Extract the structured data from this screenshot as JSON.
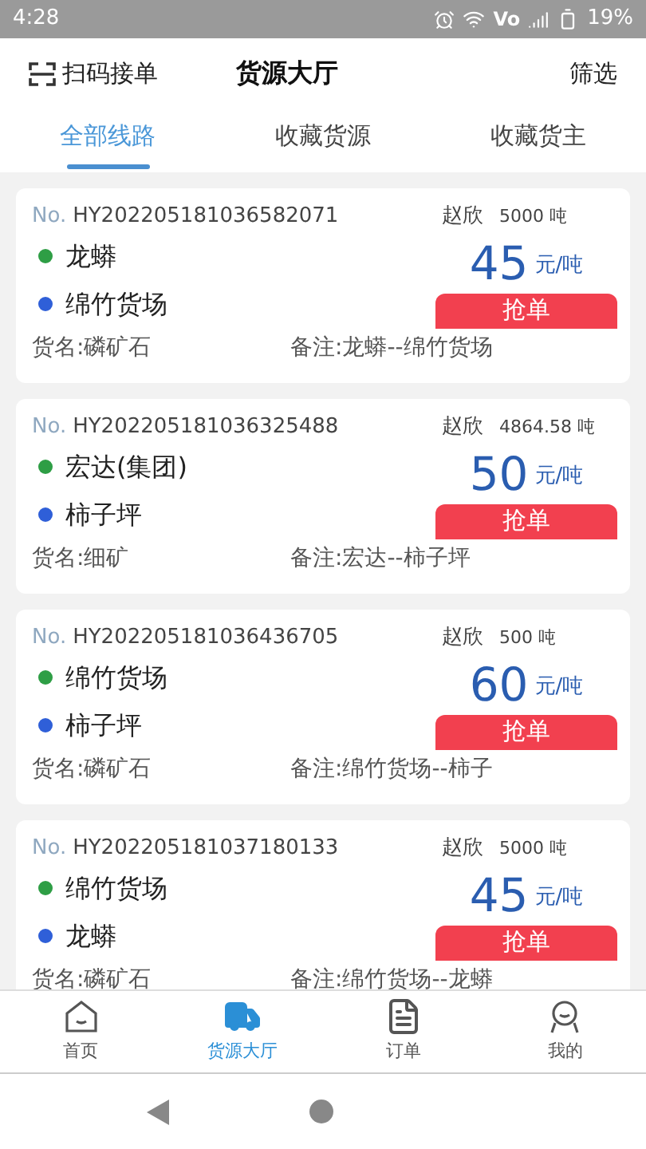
{
  "status_bar": {
    "time": "4:28",
    "network_label": "Vo",
    "battery": "19%"
  },
  "header": {
    "scan": "扫码接单",
    "title": "货源大厅",
    "filter": "筛选"
  },
  "tabs": [
    {
      "label": "全部线路",
      "selected": true
    },
    {
      "label": "收藏货源",
      "selected": false
    },
    {
      "label": "收藏货主",
      "selected": false
    }
  ],
  "orders": [
    {
      "prefix": "No.",
      "number": "HY202205181036582071",
      "shipper": "赵欣",
      "weight": "5000 吨",
      "stops": [
        {
          "name": "龙蟒",
          "color": "#2e9e45"
        },
        {
          "name": "绵竹货场",
          "color": "#2f5fd8"
        }
      ],
      "price": "45",
      "unit": "元/吨",
      "action": "抢单",
      "cargo": "货名:磷矿石",
      "note": "备注:龙蟒--绵竹货场"
    },
    {
      "prefix": "No.",
      "number": "HY202205181036325488",
      "shipper": "赵欣",
      "weight": "4864.58 吨",
      "stops": [
        {
          "name": "宏达(集团)",
          "color": "#2e9e45"
        },
        {
          "name": "柿子坪",
          "color": "#2f5fd8"
        }
      ],
      "price": "50",
      "unit": "元/吨",
      "action": "抢单",
      "cargo": "货名:细矿",
      "note": "备注:宏达--柿子坪"
    },
    {
      "prefix": "No.",
      "number": "HY202205181036436705",
      "shipper": "赵欣",
      "weight": "500 吨",
      "stops": [
        {
          "name": "绵竹货场",
          "color": "#2e9e45"
        },
        {
          "name": "柿子坪",
          "color": "#2f5fd8"
        }
      ],
      "price": "60",
      "unit": "元/吨",
      "action": "抢单",
      "cargo": "货名:磷矿石",
      "note": "备注:绵竹货场--柿子"
    },
    {
      "prefix": "No.",
      "number": "HY202205181037180133",
      "shipper": "赵欣",
      "weight": "5000 吨",
      "stops": [
        {
          "name": "绵竹货场",
          "color": "#2e9e45"
        },
        {
          "name": "龙蟒",
          "color": "#2f5fd8"
        }
      ],
      "price": "45",
      "unit": "元/吨",
      "action": "抢单",
      "cargo": "货名:磷矿石",
      "note": "备注:绵竹货场--龙蟒"
    }
  ],
  "bottom_nav": [
    {
      "kind": "home",
      "label": "首页",
      "selected": false
    },
    {
      "kind": "truck",
      "label": "货源大厅",
      "selected": true
    },
    {
      "kind": "orders",
      "label": "订单",
      "selected": false
    },
    {
      "kind": "profile",
      "label": "我的",
      "selected": false
    }
  ]
}
